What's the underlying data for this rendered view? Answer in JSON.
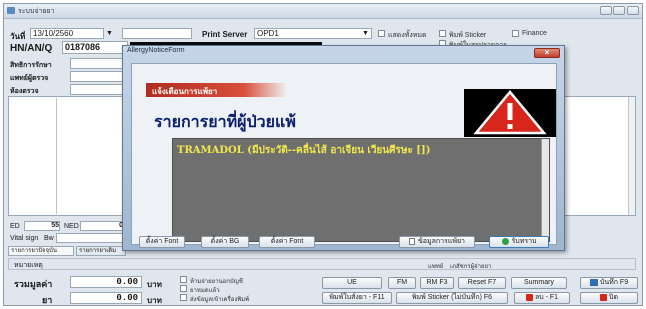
{
  "window": {
    "title": "ระบบจ่ายยา"
  },
  "form": {
    "date_label": "วันที่",
    "date_value": "13/10/2560",
    "print_server_label": "Print Server",
    "print_server_value": "OPD1",
    "hn_label": "HN/AN/Q",
    "hn_value": "0187086",
    "name_label": "ชื่อ-สกุล",
    "right_label": "สิทธิการรักษา",
    "doctor_label": "แพทย์ผู้ตรวจ",
    "clinic_label": "ห้องตรวจ",
    "opt_print_all": "แสดงทั้งหมด",
    "opt_print_sticker": "พิมพ์ Sticker",
    "opt_finance": "Finance",
    "opt_print_direct": "พิมพ์ใบสรุปรายการ"
  },
  "left_panel": {
    "ed_label": "ED",
    "ed_value": "55",
    "ned_label": "NED",
    "ned_value": "0",
    "vital_label": "Vital sign",
    "bw_label": "Bw",
    "tab_1": "รายการยาปัจจุบัน",
    "tab_2": "รายการยาเดิม",
    "note_label": "หมายเหตุ"
  },
  "status": {
    "pharmacist_label": "แพทย์",
    "pharmacist_value": "เภสัชกรผู้จ่ายยา"
  },
  "summary": {
    "total_label": "รวมมูลค่า",
    "total_value": "0.00",
    "total_unit": "บาท",
    "pay_label": "ยา",
    "pay_value": "0.00",
    "pay_unit": "บาท",
    "chk1": "ห้ามจ่ายยานอกบัญชี",
    "chk2": "ยาหมดแล้ว",
    "chk3": "ส่งข้อมูลเข้าเครื่องพิมพ์"
  },
  "buttons": {
    "ue": "UE",
    "fm": "FM",
    "rm_f3": "RM F3",
    "reset_f7": "Reset F7",
    "summary": "Summary",
    "save_f9": "บันทึก F9",
    "print_rx_f11": "พิมพ์ใบสั่งยา - F11",
    "print_sticker_f6": "พิมพ์ Sticker (ไม่บันทึก) F6",
    "delete_f1": "ลบ - F1",
    "close": "ปิด"
  },
  "dialog": {
    "title": "AllergyNoticeForm",
    "header": "แจ้งเตือนการแพ้ยา",
    "heading": "รายการยาที่ผู้ป่วยแพ้",
    "drug_text": "TRAMADOL (มีประวัติ--คลื่นไส้ อาเจียน เวียนศีรษะ [])",
    "btn_font": "ตั้งค่า Font",
    "btn_bg": "ตั้งค่า BG",
    "btn_font2": "ตั้งค่า Font",
    "btn_info": "ข้อมูลการแพ้ยา",
    "btn_ok": "รับทราบ"
  },
  "colors": {
    "dialog_header": "#c0392b",
    "drug_text": "#f2e94a",
    "drug_area": "#6f6f6f",
    "heading_text": "#0a1f6e",
    "warning_red": "#d9261c"
  },
  "icons": {
    "warning": "warning-triangle-icon",
    "ok": "check-circle-icon",
    "info": "document-icon",
    "save": "save-icon",
    "delete": "delete-icon",
    "close": "close-icon"
  }
}
